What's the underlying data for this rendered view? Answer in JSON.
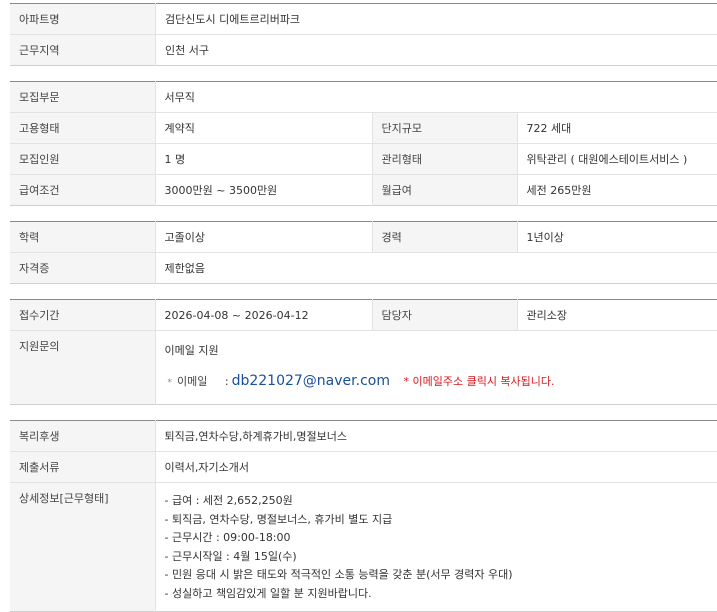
{
  "basic": {
    "apt_label": "아파트명",
    "apt_value": "검단신도시 디에트르리버파크",
    "region_label": "근무지역",
    "region_value": "인천 서구"
  },
  "recruit": {
    "dept_label": "모집부문",
    "dept_value": "서무직",
    "employ_label": "고용형태",
    "employ_value": "계약직",
    "size_label": "단지규모",
    "size_value": "722 세대",
    "count_label": "모집인원",
    "count_value": "1 명",
    "manage_label": "관리형태",
    "manage_value": "위탁관리 ( 대원에스테이트서비스 )",
    "salary_label": "급여조건",
    "salary_value": "3000만원 ~ 3500만원",
    "monthly_label": "월급여",
    "monthly_value": "세전 265만원"
  },
  "qualify": {
    "edu_label": "학력",
    "edu_value": "고졸이상",
    "career_label": "경력",
    "career_value": "1년이상",
    "cert_label": "자격증",
    "cert_value": "제한없음"
  },
  "apply": {
    "period_label": "접수기간",
    "period_value": "2026-04-08 ~ 2026-04-12",
    "manager_label": "담당자",
    "manager_value": "관리소장",
    "inquiry_label": "지원문의",
    "method": "이메일 지원",
    "bullet": "*",
    "email_label": "이메일",
    "email_colon": ":",
    "email": "db221027@naver.com",
    "notice": "* 이메일주소 클릭시 복사됩니다."
  },
  "extra": {
    "welfare_label": "복리후생",
    "welfare_value": "퇴직금,연차수당,하계휴가비,명절보너스",
    "docs_label": "제출서류",
    "docs_value": "이력서,자기소개서",
    "detail_label": "상세정보[근무형태]",
    "detail_lines": [
      "- 급여 : 세전 2,652,250원",
      "- 퇴직금, 연차수당, 명절보너스, 휴가비 별도 지급",
      "- 근무시간 : 09:00-18:00",
      "- 근무시작일 : 4월 15일(수)",
      "- 민원 응대 시 밝은 태도와 적극적인 소통 능력을 갖춘 분(서무 경력자 우대)",
      "- 성실하고 책임감있게 일할 분 지원바랍니다."
    ]
  }
}
